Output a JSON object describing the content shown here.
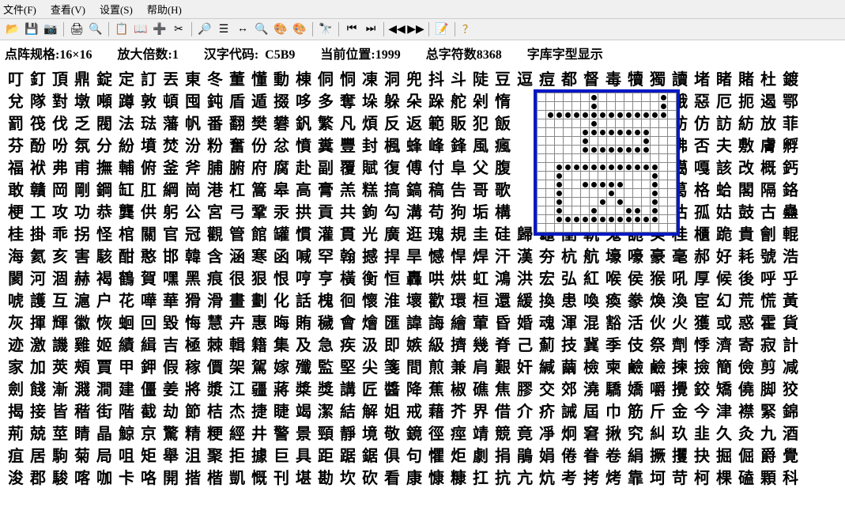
{
  "menu": {
    "file": "文件(F)",
    "view": "查看(V)",
    "settings": "设置(S)",
    "help": "帮助(H)"
  },
  "toolbar_icons": [
    "open-icon",
    "save-icon",
    "camera-icon",
    "print-icon",
    "preview-icon",
    "copy-icon",
    "book-icon",
    "add-icon",
    "cut-icon",
    "zoom-icon",
    "list-icon",
    "swap-icon",
    "find-icon",
    "color-icon",
    "color2-icon",
    "binoculars-icon",
    "first-icon",
    "last-icon",
    "prev-icon",
    "next-icon",
    "props-icon",
    "help-icon"
  ],
  "status": {
    "dot_spec_label": "点阵规格:",
    "dot_spec": "16×16",
    "zoom_label": "放大倍数:",
    "zoom": "1",
    "code_label": "汉字代码:",
    "code": "C5B9",
    "pos_label": "当前位置:",
    "pos": "1999",
    "total_label": "总字符数",
    "total": "8368",
    "fontlib": "字库字型显示"
  },
  "chars": [
    "叮釘頂鼎錠定訂丟東冬董懂動棟侗恫凍洞兜抖斗陡豆逗痘都督毒犢獨讀堵睹賭杜鍍",
    "兌隊對墩噸蹲敦頓囤鈍盾遁掇哆多奪垛躲朵跺舵剁惰　　　　　　訛娥惡厄扼遏鄂",
    "罰筏伐乏閥法琺藩帆番翻樊礬釩繁凡煩反返範販犯飯　　　　　　防妨仿訪紡放菲",
    "芬酚吩氛分紛墳焚汾粉奮份忿憤糞豐封楓蜂峰鋒風瘋　　　　　　鳳佛否夫敷膚孵",
    "福袱弗甫撫輔俯釜斧脯腑府腐赴副覆賦復傅付阜父腹　　　　　　咐噶嘎該改概鈣",
    "敢贛岡剛鋼缸肛綱崗港杠篙皋高膏羔糕搞鎬稿告哥歌　　　　　　革葛格蛤閣隔鉻",
    "梗工攻功恭龔供躬公宮弓鞏汞拱貢共鉤勾溝苟狗垢構　　　　　　估沽孤姑鼓古蠱",
    "桂掛乖拐怪棺關官冠觀管館罐慣灌貫光廣逛瑰規圭硅歸龜閨軌鬼詭癸桂櫃跪貴劊輥",
    "海氦亥害駭酣憨邯韓含涵寒函喊罕翰撼捍旱憾悍焊汗漢夯杭航壕嚎豪毫郝好耗號浩",
    "閡河涸赫褐鶴賀嘿黑痕很狠恨哼亨橫衡恒轟哄烘虹鴻洪宏弘紅喉侯猴吼厚候後呼乎",
    "唬護互滬户花嘩華猾滑畫劃化話槐徊懷淮壞歡環桓還緩換患喚瘓豢煥渙宦幻荒慌黃",
    "灰揮輝徽恢蛔回毀悔慧卉惠晦賄穢會燴匯諱誨繪葷昏婚魂渾混豁活伙火獲或惑霍貨",
    "迹激譏雞姬績緝吉極棘輯籍集及急疾汲即嫉級擠幾脊己薊技冀季伎祭劑悸濟寄寂計",
    "家加莢頰賈甲鉀假稼價架駕嫁殲監堅尖箋間煎兼肩艱奸緘繭檢柬鹼鹼揀撿簡儉剪减",
    "劍餞漸濺澗建僵姜將漿江疆蔣槳獎講匠醬降蕉椒礁焦膠交郊澆驕嬌嚼攪鉸矯僥脚狡",
    "揭接皆稭街階截劫節桔杰捷睫竭潔結解姐戒藉芥界借介疥誡屆巾筋斤金今津襟緊錦",
    "荊兢莖睛晶鯨京驚精粳經井警景頸靜境敬鏡徑痙靖競竟凈炯窘揪究糾玖韭久灸九酒",
    "疽居駒菊局咀矩舉沮聚拒據巨具距踞鋸俱句懼炬劇捐鵑娟倦眷卷絹撅攫抉掘倔爵覺",
    "浚郡駿喀咖卡咯開揩楷凱慨刊堪勘坎砍看康慷糠扛抗亢炕考拷烤靠坷苛柯棵磕顆科"
  ],
  "dotmatrix": [
    "0000001000000010",
    "0000001000000010",
    "0111111111111110",
    "0000001000000000",
    "0000011111111000",
    "0000010000001000",
    "0000011111111000",
    "0000000000000000",
    "0011111111111100",
    "0010000000000100",
    "0010011111000100",
    "0010000010000100",
    "0010000101000100",
    "0010001000110100",
    "0011111111111100",
    "0000000000000000"
  ]
}
